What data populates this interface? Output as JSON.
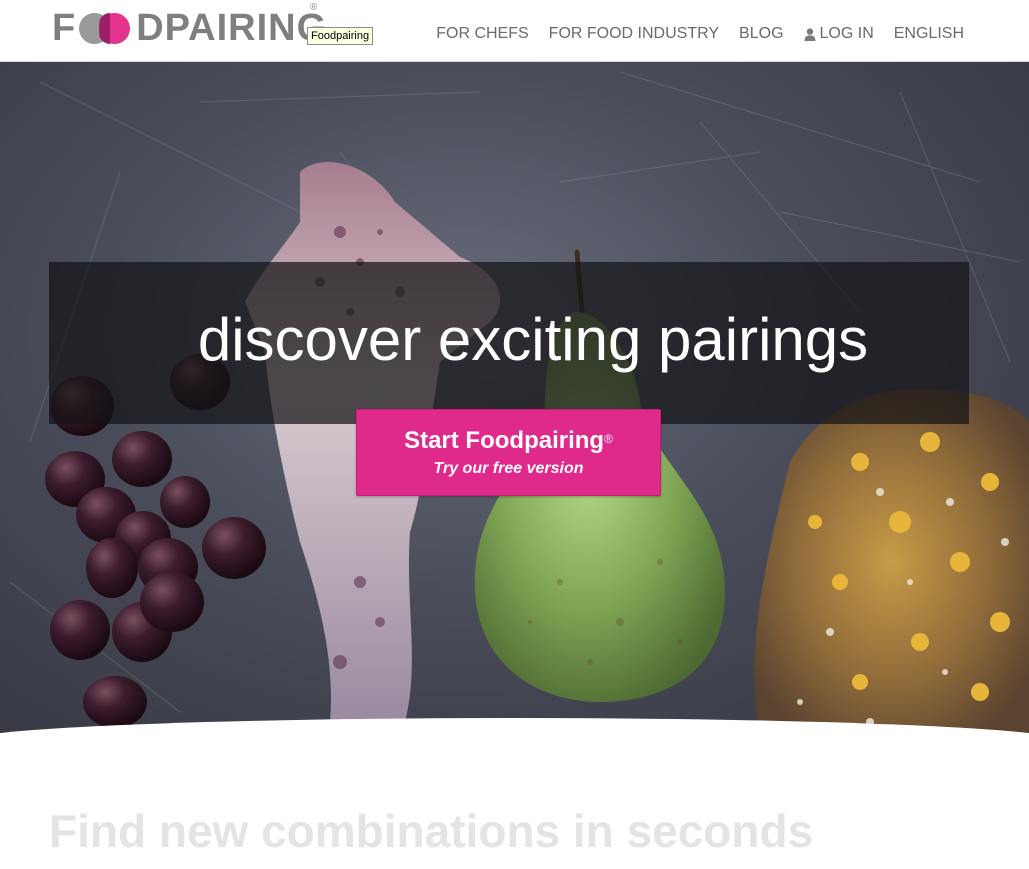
{
  "header": {
    "logo_text_start": "F",
    "logo_text_end": "DPAIRING",
    "logo_registered": "®",
    "logo_tooltip": "Foodpairing",
    "nav": [
      {
        "label": "FOR CHEFS"
      },
      {
        "label": "FOR FOOD INDUSTRY"
      },
      {
        "label": "BLOG"
      },
      {
        "label": "LOG IN",
        "icon": "user-icon"
      },
      {
        "label": "ENGLISH"
      }
    ]
  },
  "hero": {
    "headline": "discover exciting pairings",
    "cta": {
      "title": "Start Foodpairing",
      "title_mark": "®",
      "subtitle": "Try our free version"
    }
  },
  "section": {
    "title": "Find new combinations in seconds"
  },
  "colors": {
    "brand_pink": "#e02a8b",
    "logo_gray": "#7f7f7f",
    "nav_gray": "#6a6a6a",
    "slate_background": "#4a4d5a"
  }
}
